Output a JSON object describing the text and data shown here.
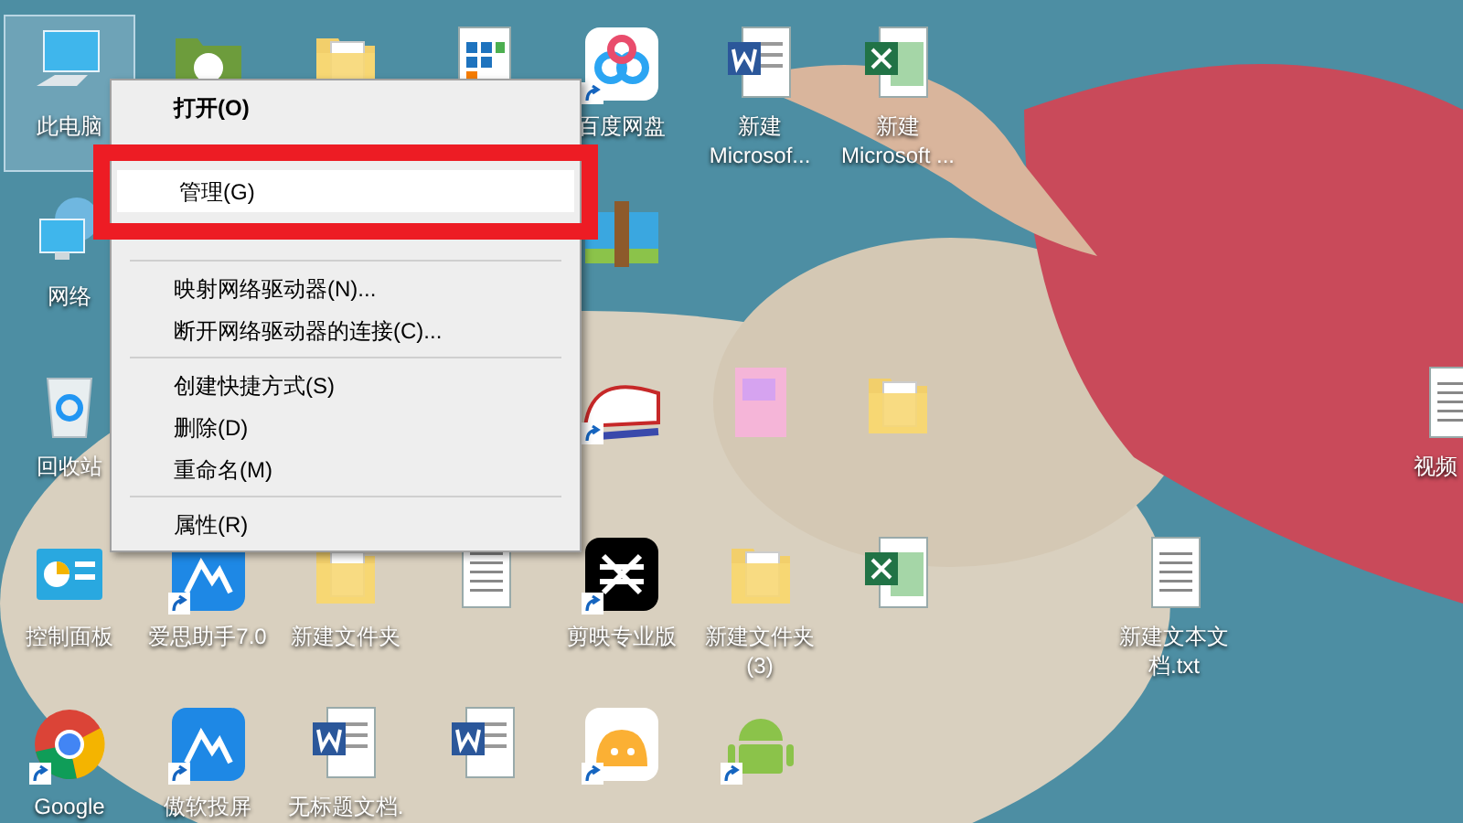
{
  "desktop": {
    "icons": [
      {
        "kind": "computer",
        "label": "此电脑",
        "selected": true,
        "shortcut": false
      },
      {
        "kind": "green-folder",
        "selected": false,
        "shortcut": false
      },
      {
        "kind": "folder",
        "selected": false,
        "shortcut": false
      },
      {
        "kind": "sheet",
        "selected": false,
        "shortcut": false
      },
      {
        "kind": "cloud",
        "label": "百度网盘",
        "selected": false,
        "shortcut": true
      },
      {
        "kind": "word",
        "label": "新建 Microsof...",
        "selected": false,
        "shortcut": false
      },
      {
        "kind": "excel",
        "label": "新建 Microsoft ...",
        "selected": false,
        "shortcut": false
      },
      {
        "kind": "network",
        "label": "网络",
        "selected": false,
        "shortcut": false
      },
      {
        "kind": "archive",
        "selected": false,
        "shortcut": false
      },
      {
        "kind": "recycle",
        "label": "回收站",
        "selected": false,
        "shortcut": false
      },
      {
        "kind": "train",
        "selected": false,
        "shortcut": true
      },
      {
        "kind": "image",
        "selected": false,
        "shortcut": false
      },
      {
        "kind": "folder",
        "selected": false,
        "shortcut": false
      },
      {
        "kind": "text",
        "label": "视频",
        "selected": false,
        "shortcut": false
      },
      {
        "kind": "control",
        "label": "控制面板",
        "selected": false,
        "shortcut": false
      },
      {
        "kind": "app-blue",
        "label": "爱思助手7.0",
        "selected": false,
        "shortcut": true
      },
      {
        "kind": "folder",
        "label": "新建文件夹",
        "selected": false,
        "shortcut": false
      },
      {
        "kind": "text",
        "selected": false,
        "shortcut": false
      },
      {
        "kind": "cut",
        "label": "剪映专业版",
        "selected": false,
        "shortcut": true
      },
      {
        "kind": "folder",
        "label": "新建文件夹 (3)",
        "selected": false,
        "shortcut": false
      },
      {
        "kind": "excel",
        "selected": false,
        "shortcut": false
      },
      {
        "kind": "text",
        "label": "新建文本文档.txt",
        "selected": false,
        "shortcut": false
      },
      {
        "kind": "chrome",
        "label": "Google",
        "selected": false,
        "shortcut": true
      },
      {
        "kind": "app-blue",
        "label": "傲软投屏",
        "selected": false,
        "shortcut": true
      },
      {
        "kind": "word",
        "label": "无标题文档.",
        "selected": false,
        "shortcut": false
      },
      {
        "kind": "word",
        "selected": false,
        "shortcut": false
      },
      {
        "kind": "app-orange",
        "selected": false,
        "shortcut": true
      },
      {
        "kind": "android",
        "selected": false,
        "shortcut": true
      }
    ]
  },
  "context_menu": {
    "items": [
      {
        "kind": "item",
        "label": "打开(O)",
        "bold": true,
        "selected": false
      },
      {
        "kind": "obscured"
      },
      {
        "kind": "item",
        "label": "管理(G)",
        "bold": false,
        "selected": true
      },
      {
        "kind": "obscured"
      },
      {
        "kind": "separator"
      },
      {
        "kind": "item",
        "label": "映射网络驱动器(N)...",
        "bold": false,
        "selected": false
      },
      {
        "kind": "item",
        "label": "断开网络驱动器的连接(C)...",
        "bold": false,
        "selected": false
      },
      {
        "kind": "separator"
      },
      {
        "kind": "item",
        "label": "创建快捷方式(S)",
        "bold": false,
        "selected": false
      },
      {
        "kind": "item",
        "label": "删除(D)",
        "bold": false,
        "selected": false
      },
      {
        "kind": "item",
        "label": "重命名(M)",
        "bold": false,
        "selected": false
      },
      {
        "kind": "separator"
      },
      {
        "kind": "item",
        "label": "属性(R)",
        "bold": false,
        "selected": false
      }
    ]
  }
}
